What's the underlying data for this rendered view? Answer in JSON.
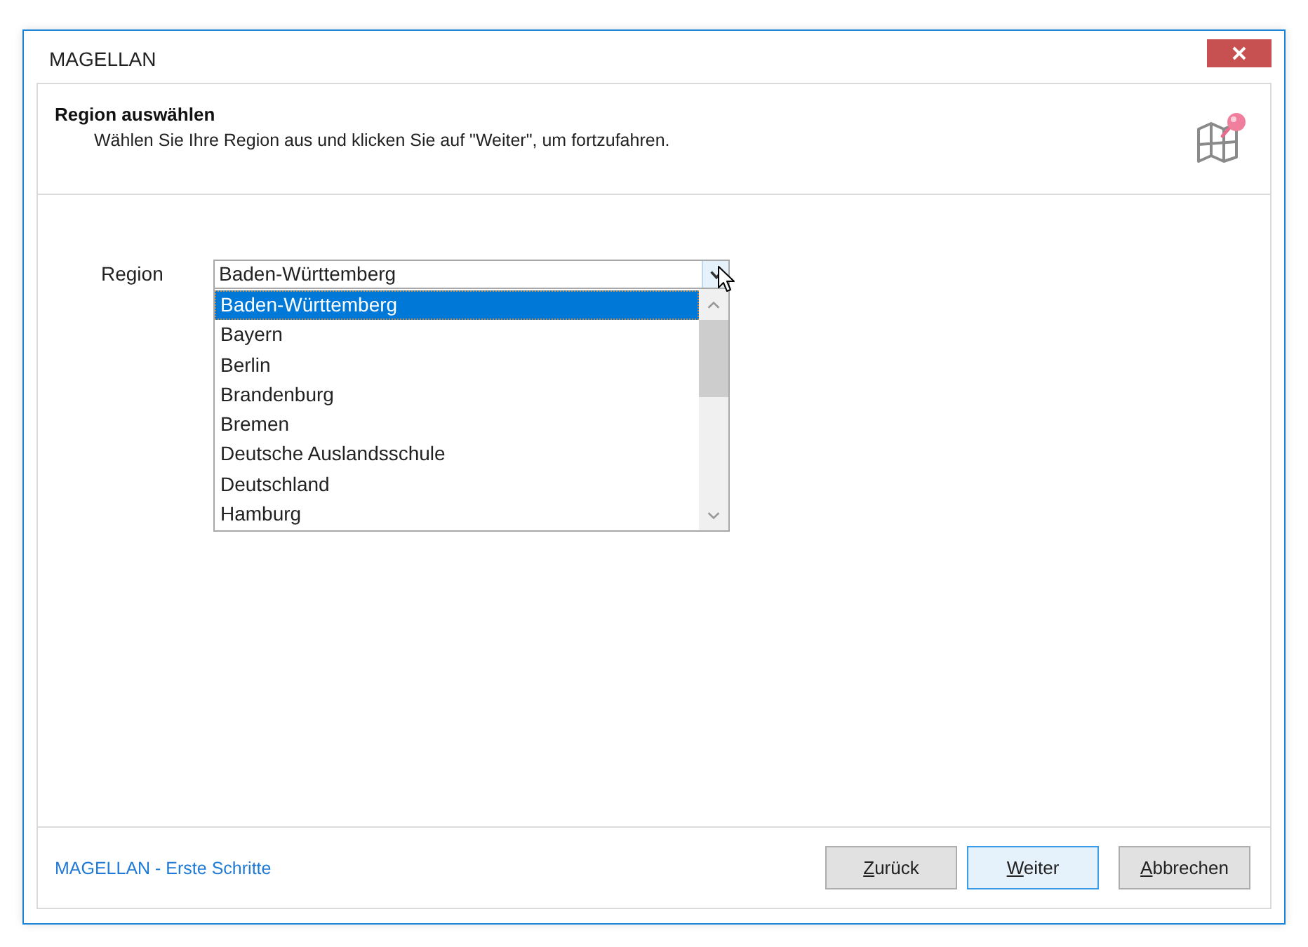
{
  "window": {
    "title": "MAGELLAN"
  },
  "header": {
    "title": "Region auswählen",
    "subtitle": "Wählen Sie Ihre Region aus und klicken Sie auf \"Weiter\", um fortzufahren."
  },
  "form": {
    "label": "Region",
    "value": "Baden-Württemberg",
    "expanded": true,
    "options": [
      {
        "label": "Baden-Württemberg",
        "selected": true
      },
      {
        "label": "Bayern",
        "selected": false
      },
      {
        "label": "Berlin",
        "selected": false
      },
      {
        "label": "Brandenburg",
        "selected": false
      },
      {
        "label": "Bremen",
        "selected": false
      },
      {
        "label": "Deutsche Auslandsschule",
        "selected": false
      },
      {
        "label": "Deutschland",
        "selected": false
      },
      {
        "label": "Hamburg",
        "selected": false
      }
    ]
  },
  "footer": {
    "link": "MAGELLAN - Erste Schritte",
    "buttons": [
      {
        "label": "Zurück",
        "first_letter_underlined": true,
        "default": false
      },
      {
        "label": "Weiter",
        "first_letter_underlined": true,
        "default": true
      },
      {
        "label": "Abbrechen",
        "first_letter_underlined": true,
        "default": false
      }
    ]
  }
}
